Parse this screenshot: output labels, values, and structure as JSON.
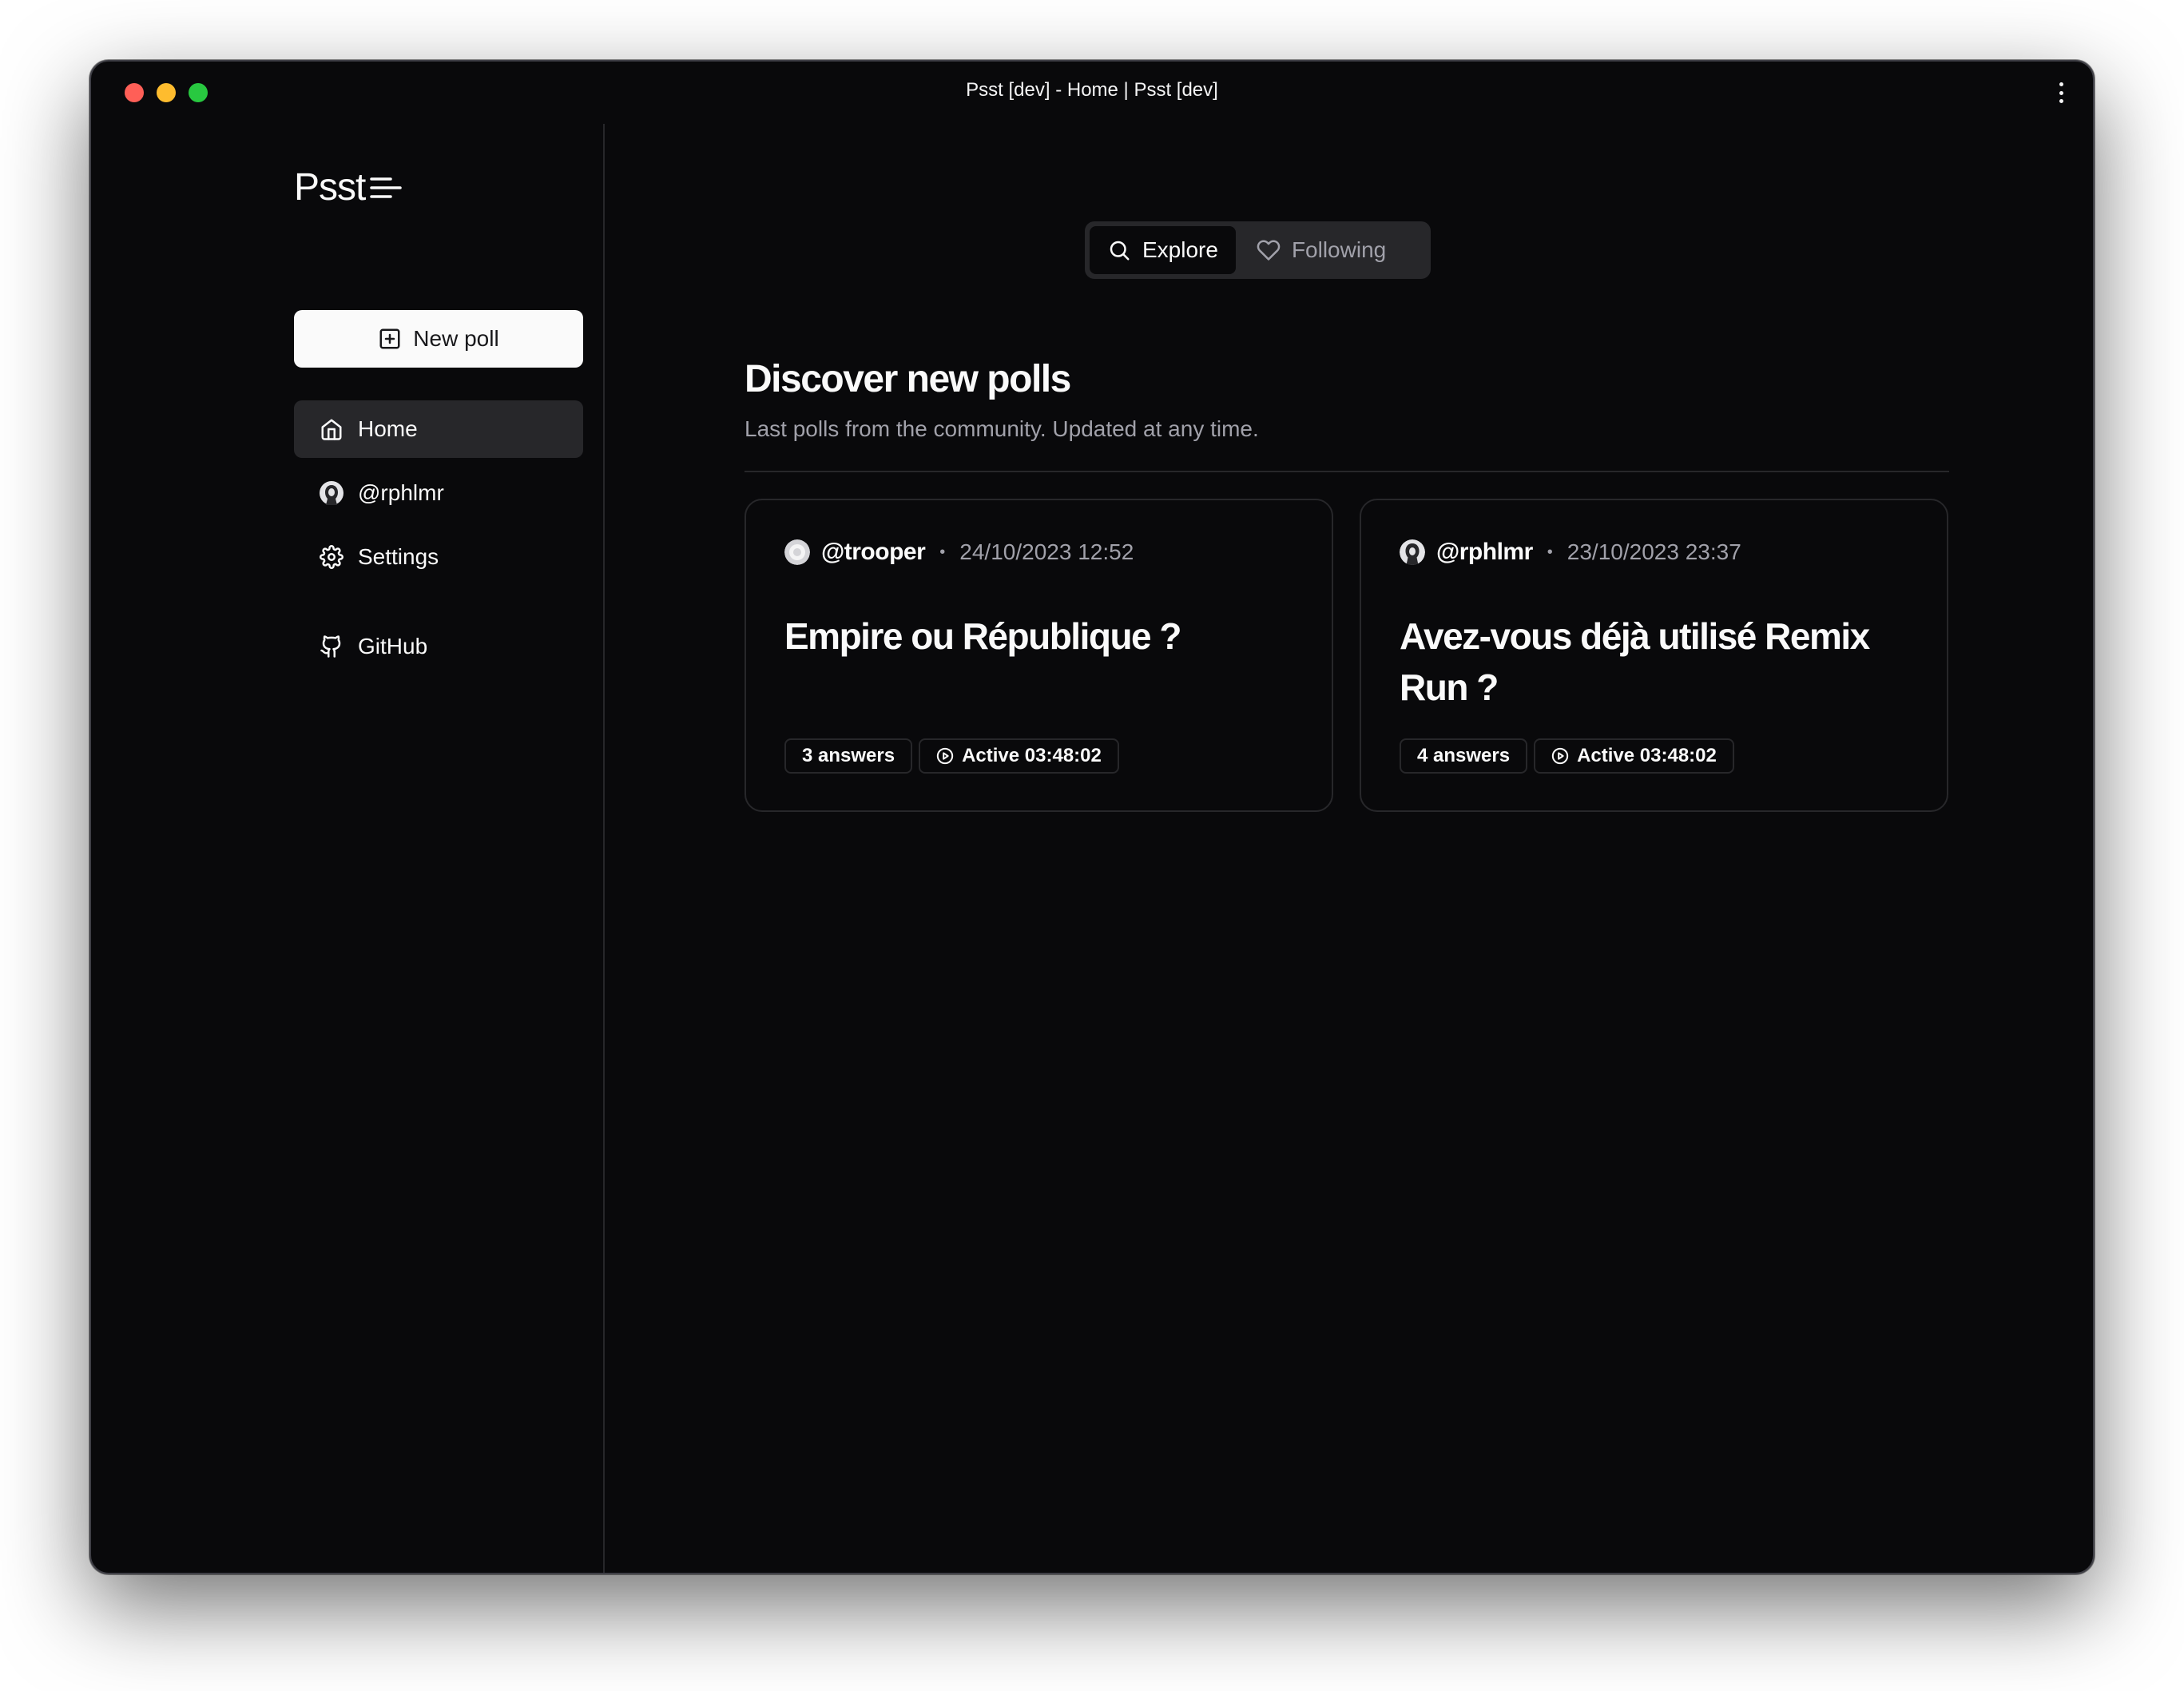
{
  "window": {
    "title": "Psst [dev] - Home | Psst [dev]"
  },
  "sidebar": {
    "logo": "Psst",
    "new_poll_label": "New poll",
    "items": [
      {
        "label": "Home",
        "icon": "home-icon",
        "active": true
      },
      {
        "label": "@rphlmr",
        "icon": "avatar"
      },
      {
        "label": "Settings",
        "icon": "gear-icon"
      },
      {
        "label": "GitHub",
        "icon": "github-icon"
      }
    ]
  },
  "tabs": [
    {
      "label": "Explore",
      "icon": "search-icon",
      "active": true
    },
    {
      "label": "Following",
      "icon": "heart-icon",
      "active": false
    }
  ],
  "main": {
    "title": "Discover new polls",
    "subtitle": "Last polls from the community. Updated at any time."
  },
  "polls": [
    {
      "author": "@trooper",
      "date": "24/10/2023 12:52",
      "question": "Empire ou République ?",
      "answers": "3 answers",
      "status": "Active 03:48:02"
    },
    {
      "author": "@rphlmr",
      "date": "23/10/2023 23:37",
      "question": "Avez-vous déjà utilisé Remix Run ?",
      "answers": "4 answers",
      "status": "Active 03:48:02"
    }
  ],
  "colors": {
    "background": "#09090b",
    "border": "#27272a",
    "muted_text": "#a1a1aa",
    "foreground": "#fafafa"
  }
}
